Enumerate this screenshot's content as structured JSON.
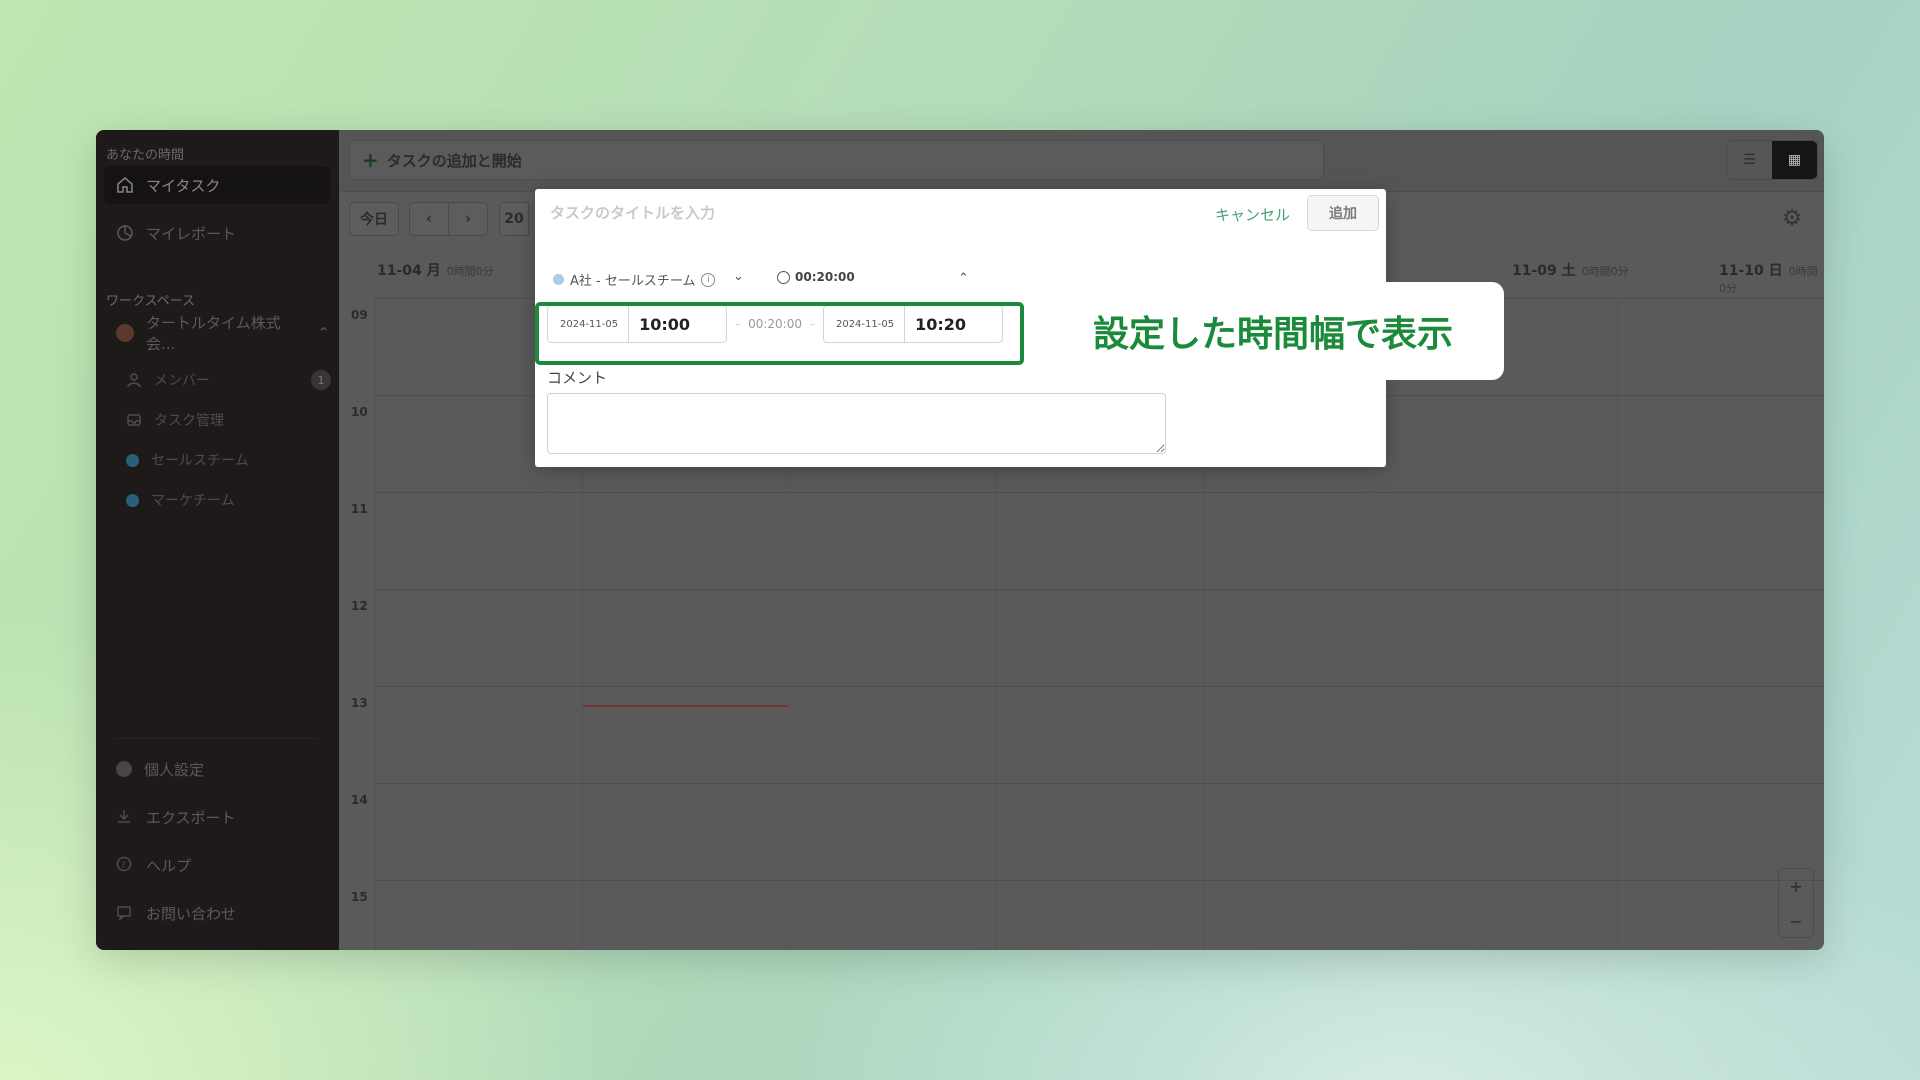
{
  "sidebar": {
    "your_time_label": "あなたの時間",
    "my_tasks": "マイタスク",
    "my_report": "マイレポート",
    "workspace_label": "ワークスペース",
    "workspace_name": "タートルタイム株式会...",
    "members": "メンバー",
    "members_count": "1",
    "task_management": "タスク管理",
    "team_sales": "セールスチーム",
    "team_marketing": "マーケチーム",
    "personal_settings": "個人設定",
    "export": "エクスポート",
    "help": "ヘルプ",
    "contact": "お問い合わせ"
  },
  "topbar": {
    "add_task": "タスクの追加と開始"
  },
  "toolbar": {
    "today": "今日",
    "prev": "‹",
    "next": "›",
    "year_partial": "20"
  },
  "days": [
    {
      "date": "11-04 月",
      "total": "0時間0分"
    },
    {
      "date": "11-09 土",
      "total": "0時間0分"
    },
    {
      "date": "11-10 日",
      "total": "0時間0分"
    }
  ],
  "hours": [
    "09",
    "10",
    "11",
    "12",
    "13",
    "14",
    "15"
  ],
  "modal": {
    "title_placeholder": "タスクのタイトルを入力",
    "cancel": "キャンセル",
    "add": "追加",
    "team": "A社 - セールスチーム",
    "duration": "00:20:00",
    "start_date": "2024-11-05",
    "start_time": "10:00",
    "mid_duration": "00:20:00",
    "end_date": "2024-11-05",
    "end_time": "10:20",
    "comment_label": "コメント"
  },
  "callout": {
    "text": "設定した時間幅で表示"
  },
  "colors": {
    "accent_green": "#1b8a3a",
    "cancel_green": "#3fa577"
  }
}
